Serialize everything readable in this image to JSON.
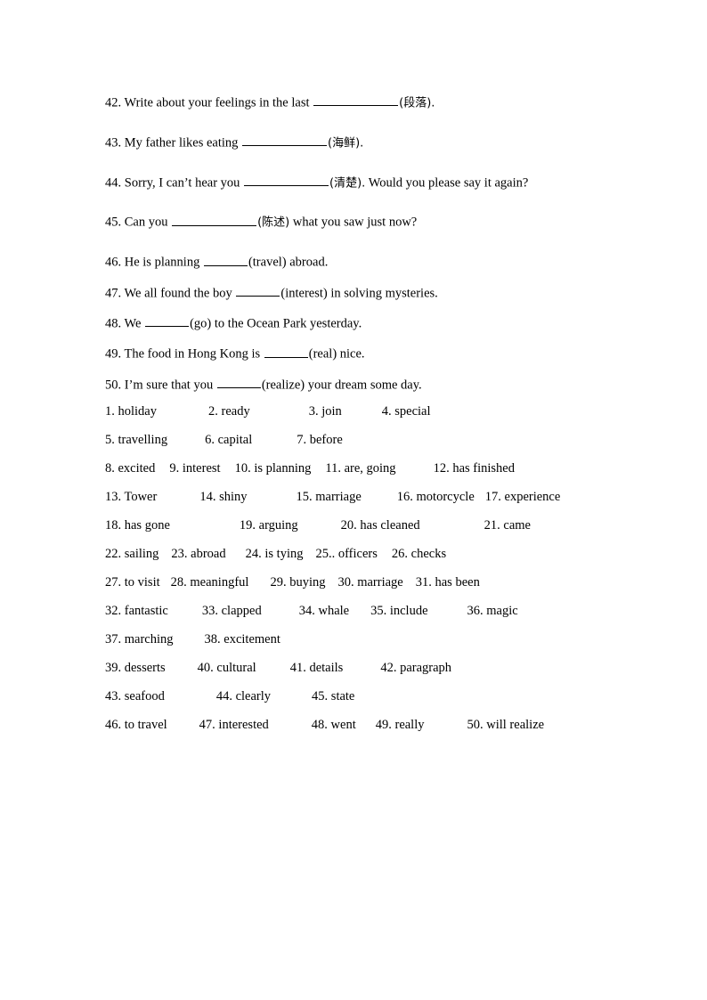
{
  "document": {
    "type": "worksheet-answer-sheet",
    "page_background": "#ffffff",
    "text_color": "#000000"
  },
  "questions": [
    {
      "number": "42.",
      "before": "Write about your feelings in the last",
      "blank": "long",
      "hint": "(段落).",
      "after": "",
      "spacing": "wide"
    },
    {
      "number": "43.",
      "before": "My father likes eating",
      "blank": "long",
      "hint": "(海鲜).",
      "after": "",
      "spacing": "wide"
    },
    {
      "number": "44.",
      "before": "Sorry, I can’t hear you",
      "blank": "long",
      "hint": "(清楚).",
      "after": "Would you please say it again?",
      "spacing": "wide"
    },
    {
      "number": "45.",
      "before": "Can you",
      "blank": "long",
      "hint": "(陈述)",
      "after": "what you saw just now?",
      "spacing": "wide"
    },
    {
      "number": "46.",
      "before": "He is planning",
      "blank": "short",
      "hint": "(travel)",
      "after": "abroad.",
      "spacing": "tight"
    },
    {
      "number": "47.",
      "before": "We all found the boy",
      "blank": "short",
      "hint": "(interest)",
      "after": "in solving mysteries.",
      "spacing": "tight"
    },
    {
      "number": "48.",
      "before": "We",
      "blank": "short",
      "hint": "(go)",
      "after": "to the Ocean Park yesterday.",
      "spacing": "tight"
    },
    {
      "number": "49.",
      "before": "The food in Hong Kong is",
      "blank": "short",
      "hint": "(real)",
      "after": "nice.",
      "spacing": "tight"
    },
    {
      "number": "50.",
      "before": "I’m sure that you",
      "blank": "short",
      "hint": "(realize)",
      "after": "your dream some day.",
      "spacing": "tight"
    }
  ],
  "answer_key": {
    "rows": [
      {
        "items": [
          {
            "text": "1. holiday",
            "gap_after": 58
          },
          {
            "text": "2. ready",
            "gap_after": 66
          },
          {
            "text": "3. join",
            "gap_after": 45
          },
          {
            "text": "4. special",
            "gap_after": 0
          }
        ]
      },
      {
        "items": [
          {
            "text": "5. travelling",
            "gap_after": 42
          },
          {
            "text": "6. capital",
            "gap_after": 50
          },
          {
            "text": "7. before",
            "gap_after": 0
          }
        ]
      },
      {
        "items": [
          {
            "text": "8. excited",
            "gap_after": 16
          },
          {
            "text": "9. interest",
            "gap_after": 16
          },
          {
            "text": "10. is planning",
            "gap_after": 16
          },
          {
            "text": "11. are, going",
            "gap_after": 42
          },
          {
            "text": "12. has finished",
            "gap_after": 0
          }
        ]
      },
      {
        "items": [
          {
            "text": "13. Tower",
            "gap_after": 48
          },
          {
            "text": "14. shiny",
            "gap_after": 55
          },
          {
            "text": "15. marriage",
            "gap_after": 40
          },
          {
            "text": "16. motorcycle",
            "gap_after": 12
          },
          {
            "text": "17. experience",
            "gap_after": 0
          }
        ]
      },
      {
        "items": [
          {
            "text": "18. has gone",
            "gap_after": 78
          },
          {
            "text": "19. arguing",
            "gap_after": 48
          },
          {
            "text": "20. has cleaned",
            "gap_after": 72
          },
          {
            "text": "21. came",
            "gap_after": 0
          }
        ]
      },
      {
        "items": [
          {
            "text": "22. sailing",
            "gap_after": 14
          },
          {
            "text": "23. abroad",
            "gap_after": 22
          },
          {
            "text": "24. is tying",
            "gap_after": 14
          },
          {
            "text": "25.. officers",
            "gap_after": 16
          },
          {
            "text": "26. checks",
            "gap_after": 0
          }
        ]
      },
      {
        "items": [
          {
            "text": "27. to visit",
            "gap_after": 12
          },
          {
            "text": "28. meaningful",
            "gap_after": 24
          },
          {
            "text": "29. buying",
            "gap_after": 14
          },
          {
            "text": "30. marriage",
            "gap_after": 14
          },
          {
            "text": "31. has been",
            "gap_after": 0
          }
        ]
      },
      {
        "items": [
          {
            "text": "32. fantastic",
            "gap_after": 38
          },
          {
            "text": "33. clapped",
            "gap_after": 42
          },
          {
            "text": "34. whale",
            "gap_after": 24
          },
          {
            "text": "35. include",
            "gap_after": 44
          },
          {
            "text": "36. magic",
            "gap_after": 0
          }
        ]
      },
      {
        "items": [
          {
            "text": "37. marching",
            "gap_after": 35
          },
          {
            "text": "38. excitement",
            "gap_after": 0
          }
        ]
      },
      {
        "items": [
          {
            "text": "39. desserts",
            "gap_after": 36
          },
          {
            "text": "40. cultural",
            "gap_after": 38
          },
          {
            "text": "41. details",
            "gap_after": 42
          },
          {
            "text": "42. paragraph",
            "gap_after": 0
          }
        ]
      },
      {
        "items": [
          {
            "text": "43. seafood",
            "gap_after": 58
          },
          {
            "text": "44. clearly",
            "gap_after": 46
          },
          {
            "text": "45. state",
            "gap_after": 0
          }
        ]
      },
      {
        "items": [
          {
            "text": "46. to travel",
            "gap_after": 36
          },
          {
            "text": "47. interested",
            "gap_after": 48
          },
          {
            "text": "48. went",
            "gap_after": 22
          },
          {
            "text": "49. really",
            "gap_after": 48
          },
          {
            "text": "50. will realize",
            "gap_after": 0
          }
        ]
      }
    ]
  }
}
